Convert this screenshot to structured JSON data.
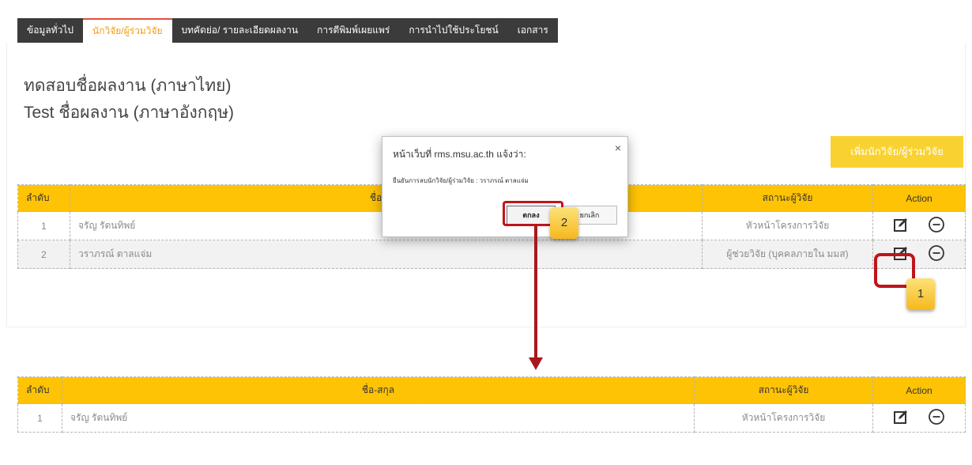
{
  "tabs": [
    {
      "label": "ข้อมูลทั่วไป",
      "active": false
    },
    {
      "label": "นักวิจัย/ผู้ร่วมวิจัย",
      "active": true
    },
    {
      "label": "บทคัดย่อ/ รายละเอียดผลงาน",
      "active": false
    },
    {
      "label": "การตีพิมพ์เผยแพร่",
      "active": false
    },
    {
      "label": "การนำไปใช้ประโยชน์",
      "active": false
    },
    {
      "label": "เอกสาร",
      "active": false
    }
  ],
  "work": {
    "title_th": "ทดสอบชื่อผลงาน (ภาษาไทย)",
    "title_en": "Test ชื่อผลงาน (ภาษาอังกฤษ)"
  },
  "add_button": "เพิ่มนักวิจัย/ผู้ร่วมวิจัย",
  "table": {
    "headers": {
      "idx": "ลำดับ",
      "name": "ชื่อ-สกุล",
      "status": "สถานะผู้วิจัย",
      "action": "Action"
    },
    "rows_before": [
      {
        "idx": "1",
        "name": "จรัญ รัตนทิพย์",
        "status": "หัวหน้าโครงการวิจัย"
      },
      {
        "idx": "2",
        "name": "วราภรณ์ ตาลแจ่ม",
        "status": "ผู้ช่วยวิจัย (บุคคลภายใน มมส)"
      }
    ],
    "rows_after": [
      {
        "idx": "1",
        "name": "จรัญ รัตนทิพย์",
        "status": "หัวหน้าโครงการวิจัย"
      }
    ]
  },
  "dialog": {
    "title": "หน้าเว็บที่ rms.msu.ac.th แจ้งว่า:",
    "close": "×",
    "message": "ยืนยันการลบนักวิจัย/ผู้ร่วมวิจัย : วราภรณ์ ตาลแจ่ม",
    "ok": "ตกลง",
    "cancel": "ยกเลิก"
  },
  "callouts": {
    "step1": "1",
    "step2": "2"
  },
  "colors": {
    "accent": "#ffc305",
    "highlight": "#c0141c",
    "tabbar": "#3b3b3b",
    "active_tab_text": "#f39c12"
  },
  "icons": [
    "edit-icon",
    "remove-circle-icon"
  ]
}
